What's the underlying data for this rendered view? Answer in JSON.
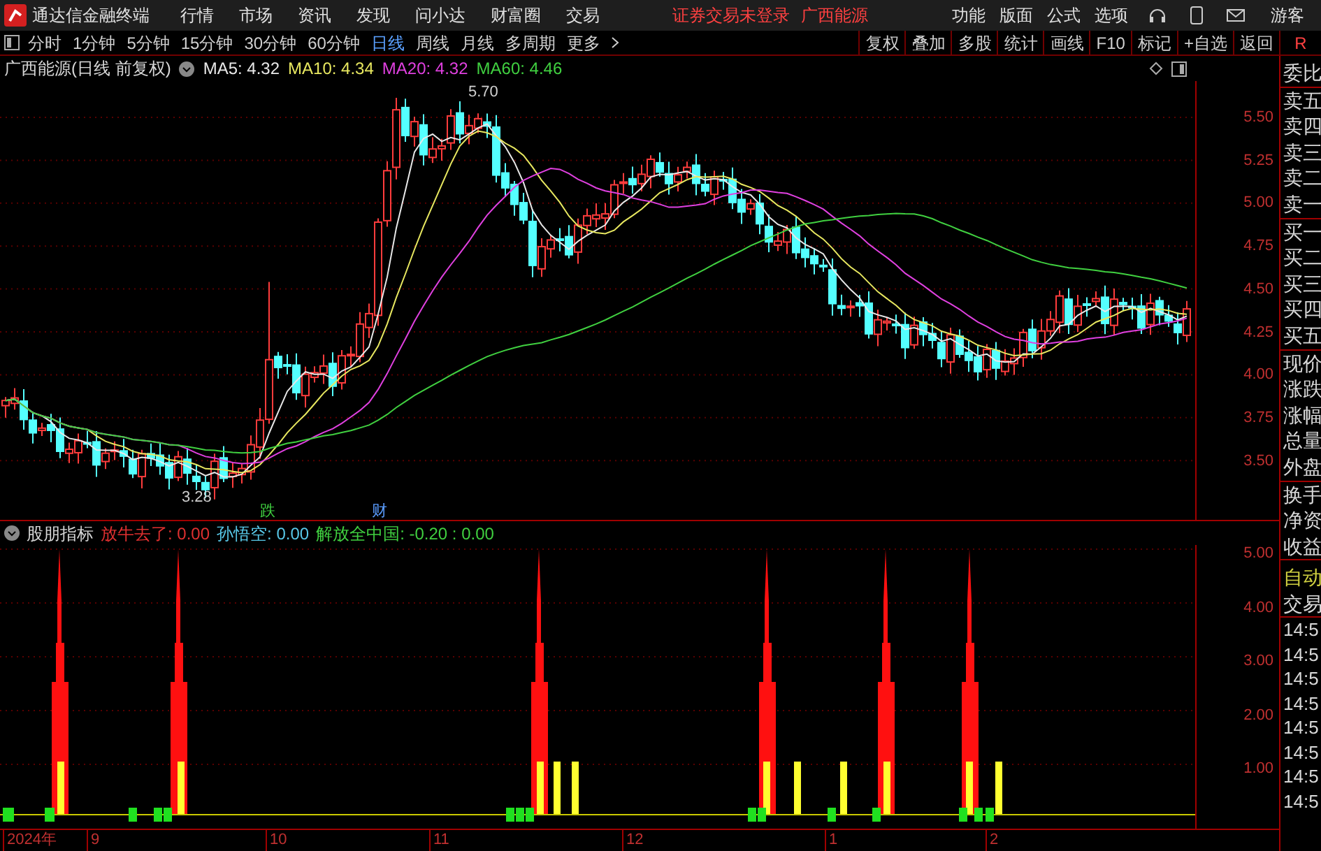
{
  "app_bar": {
    "title": "通达信金融终端",
    "menu": [
      "行情",
      "市场",
      "资讯",
      "发现",
      "问小达",
      "财富圈",
      "交易"
    ],
    "notice": "证券交易未登录",
    "stock_name": "广西能源",
    "tools": [
      "功能",
      "版面",
      "公式",
      "选项"
    ],
    "user": "游客"
  },
  "period_bar": {
    "periods": [
      {
        "label": "分时",
        "selected": false
      },
      {
        "label": "1分钟",
        "selected": false
      },
      {
        "label": "5分钟",
        "selected": false
      },
      {
        "label": "15分钟",
        "selected": false
      },
      {
        "label": "30分钟",
        "selected": false
      },
      {
        "label": "60分钟",
        "selected": false
      },
      {
        "label": "日线",
        "selected": true
      },
      {
        "label": "周线",
        "selected": false
      },
      {
        "label": "月线",
        "selected": false
      },
      {
        "label": "多周期",
        "selected": false
      },
      {
        "label": "更多",
        "selected": false
      }
    ],
    "actions": [
      "复权",
      "叠加",
      "多股",
      "统计",
      "画线",
      "F10",
      "标记",
      "+自选",
      "返回"
    ],
    "corner": "R"
  },
  "price_chart": {
    "title": "广西能源(日线 前复权)",
    "ma": [
      {
        "label": "MA5: 4.32",
        "color": "#e8e8e8"
      },
      {
        "label": "MA10: 4.34",
        "color": "#e8e860"
      },
      {
        "label": "MA20: 4.32",
        "color": "#e040e0"
      },
      {
        "label": "MA60: 4.46",
        "color": "#40d040"
      }
    ],
    "high_label": "5.70",
    "low_label": "3.28",
    "event_marks": [
      {
        "text": "跌",
        "color": "#40d040"
      },
      {
        "text": "财",
        "color": "#5a9cff"
      }
    ],
    "axis_labels": [
      "5.50",
      "5.25",
      "5.00",
      "4.75",
      "4.50",
      "4.25",
      "4.00",
      "3.75",
      "3.50"
    ]
  },
  "indicator": {
    "name": "股朋指标",
    "lines": [
      {
        "label": "放牛去了: 0.00",
        "color": "#e03030"
      },
      {
        "label": "孙悟空: 0.00",
        "color": "#58c8e8"
      },
      {
        "label": "解放全中国: -0.20 : 0.00",
        "color": "#40d040"
      }
    ],
    "axis_labels": [
      "5.00",
      "4.00",
      "3.00",
      "2.00",
      "1.00"
    ]
  },
  "date_axis": [
    "2024年",
    "9",
    "10",
    "11",
    "12",
    "1",
    "2"
  ],
  "quote_panel": {
    "groups": [
      [
        "委比"
      ],
      [
        "卖五",
        "卖四",
        "卖三",
        "卖二",
        "卖一"
      ],
      [
        "买一",
        "买二",
        "买三",
        "买四",
        "买五"
      ],
      [
        "现价",
        "涨跌",
        "涨幅",
        "总量",
        "外盘"
      ],
      [
        "换手",
        "净资",
        "收益"
      ]
    ],
    "mode": "自动",
    "trade": "交易",
    "times": [
      "14:5",
      "14:5",
      "14:5",
      "14:5",
      "14:5",
      "14:5",
      "14:5",
      "14:5"
    ]
  }
}
